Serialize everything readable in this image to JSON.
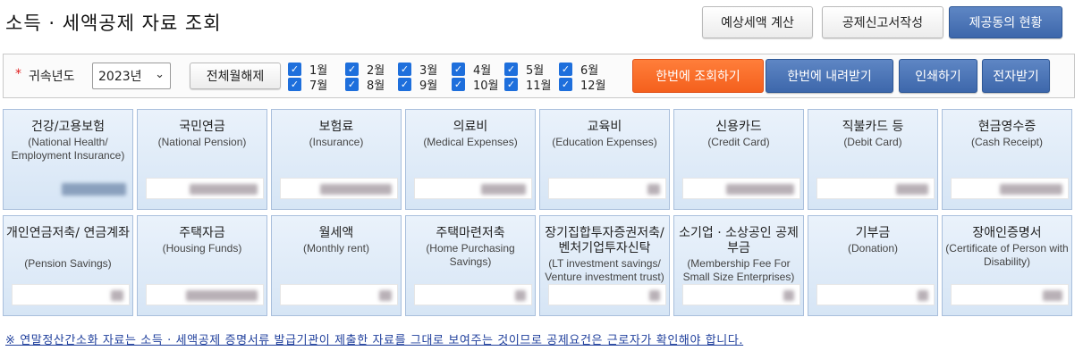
{
  "page": {
    "title": "소득 · 세액공제 자료 조회"
  },
  "top_buttons": {
    "estimate": "예상세액 계산",
    "report": "공제신고서작성",
    "status": "제공동의 현황"
  },
  "filter": {
    "required_mark": "*",
    "year_label": "귀속년도",
    "year_value": "2023년",
    "deselect_all": "전체월해제",
    "months": [
      {
        "label": "1월",
        "checked": true
      },
      {
        "label": "2월",
        "checked": true
      },
      {
        "label": "3월",
        "checked": true
      },
      {
        "label": "4월",
        "checked": true
      },
      {
        "label": "5월",
        "checked": true
      },
      {
        "label": "6월",
        "checked": true
      },
      {
        "label": "7월",
        "checked": true
      },
      {
        "label": "8월",
        "checked": true
      },
      {
        "label": "9월",
        "checked": true
      },
      {
        "label": "10월",
        "checked": true
      },
      {
        "label": "11월",
        "checked": true
      },
      {
        "label": "12월",
        "checked": true
      }
    ],
    "actions": {
      "query_all": "한번에 조회하기",
      "download_all": "한번에 내려받기",
      "print": "인쇄하기",
      "e_receive": "전자받기"
    }
  },
  "cards": [
    {
      "ko": "건강/고용보험",
      "en": "(National Health/ Employment Insurance)"
    },
    {
      "ko": "국민연금",
      "en": "(National Pension)"
    },
    {
      "ko": "보험료",
      "en": "(Insurance)"
    },
    {
      "ko": "의료비",
      "en": "(Medical Expenses)"
    },
    {
      "ko": "교육비",
      "en": "(Education Expenses)"
    },
    {
      "ko": "신용카드",
      "en": "(Credit Card)"
    },
    {
      "ko": "직불카드 등",
      "en": "(Debit Card)"
    },
    {
      "ko": "현금영수증",
      "en": "(Cash Receipt)"
    },
    {
      "ko": "개인연금저축/ 연금계좌",
      "en": "(Pension Savings)"
    },
    {
      "ko": "주택자금",
      "en": "(Housing Funds)"
    },
    {
      "ko": "월세액",
      "en": "(Monthly rent)"
    },
    {
      "ko": "주택마련저축",
      "en": "(Home Purchasing Savings)"
    },
    {
      "ko": "장기집합투자증권저축/ 벤처기업투자신탁",
      "en": "(LT investment savings/ Venture investment trust)"
    },
    {
      "ko": "소기업 · 소상공인 공제부금",
      "en": "(Membership Fee For Small Size Enterprises)"
    },
    {
      "ko": "기부금",
      "en": "(Donation)"
    },
    {
      "ko": "장애인증명서",
      "en": "(Certificate of Person with Disability)"
    }
  ],
  "notice": "※ 연말정산간소화 자료는 소득 · 세액공제 증명서류 발급기관이 제출한 자료를 그대로 보여주는 것이므로 공제요건은 근로자가 확인해야 합니다."
}
